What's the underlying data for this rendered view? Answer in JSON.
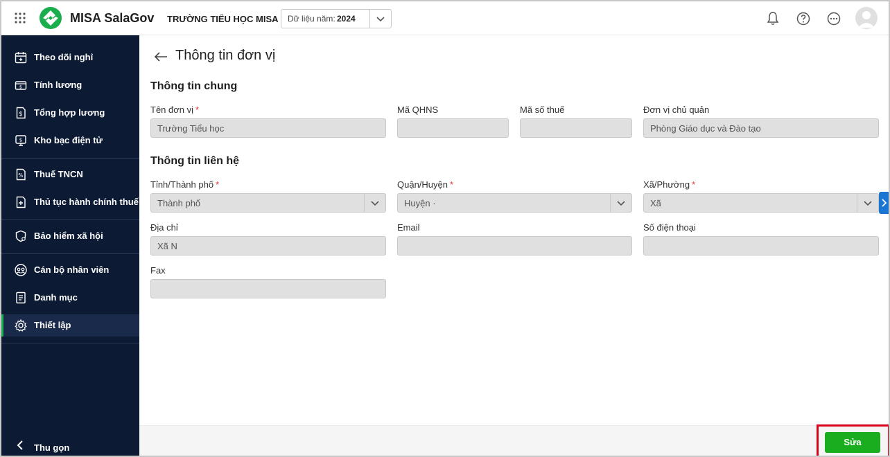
{
  "header": {
    "app_name": "MISA SalaGov",
    "org_name": "TRƯỜNG TIỂU HỌC MISA",
    "year_label": "Dữ liệu năm:",
    "year_value": "2024",
    "icons": [
      "apps-grid-icon",
      "bell-icon",
      "help-icon",
      "more-icon",
      "avatar"
    ]
  },
  "sidebar": {
    "items": [
      {
        "label": "Theo dõi nghỉ",
        "icon": "calendar-icon"
      },
      {
        "label": "Tính lương",
        "icon": "money-icon"
      },
      {
        "label": "Tổng hợp lương",
        "icon": "dollar-doc-icon"
      },
      {
        "label": "Kho bạc điện tử",
        "icon": "treasury-icon"
      },
      {
        "label": "Thuế TNCN",
        "icon": "tax-doc-icon"
      },
      {
        "label": "Thủ tục hành chính thuế",
        "icon": "tax-procedure-icon"
      },
      {
        "label": "Bảo hiểm xã hội",
        "icon": "shield-icon"
      },
      {
        "label": "Cán bộ nhân viên",
        "icon": "people-icon"
      },
      {
        "label": "Danh mục",
        "icon": "list-icon"
      },
      {
        "label": "Thiết lập",
        "icon": "gear-icon"
      }
    ],
    "active_item": "Thiết lập",
    "collapse_label": "Thu gọn"
  },
  "page": {
    "title": "Thông tin đơn vị",
    "general_section": "Thông tin chung",
    "contact_section": "Thông tin liên hệ",
    "fields": {
      "unit_name": {
        "label": "Tên đơn vị",
        "required": "*",
        "value": "Trường Tiểu học "
      },
      "qhns_code": {
        "label": "Mã QHNS",
        "value": ""
      },
      "tax_code": {
        "label": "Mã số thuế",
        "value": ""
      },
      "parent_unit": {
        "label": "Đơn vị chủ quản",
        "value": "Phòng Giáo dục và Đào tạo"
      },
      "province": {
        "label": "Tỉnh/Thành phố",
        "required": "*",
        "value": "Thành phố"
      },
      "district": {
        "label": "Quận/Huyện",
        "required": "*",
        "value": "Huyện ·"
      },
      "ward": {
        "label": "Xã/Phường",
        "required": "*",
        "value": "Xã"
      },
      "address": {
        "label": "Địa chỉ",
        "value": "Xã N"
      },
      "email": {
        "label": "Email",
        "value": ""
      },
      "phone": {
        "label": "Số điện thoại",
        "value": ""
      },
      "fax": {
        "label": "Fax",
        "value": ""
      }
    }
  },
  "footer": {
    "edit_label": "Sửa"
  },
  "colors": {
    "sidebar_bg": "#0c1a33",
    "brand_green": "#1aad4c",
    "button_green": "#1aad1f",
    "highlight_red": "#d9001b",
    "required_red": "#e53935"
  }
}
